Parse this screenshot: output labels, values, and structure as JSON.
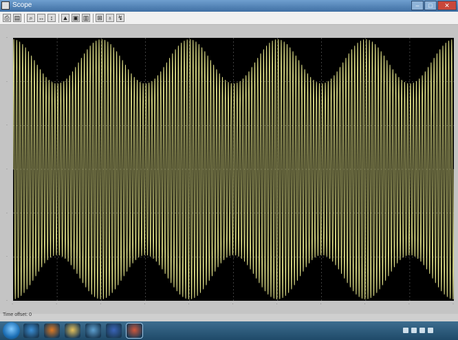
{
  "window": {
    "title": "Scope"
  },
  "toolbar": {
    "buttons": [
      {
        "name": "print-icon",
        "glyph": "⎙"
      },
      {
        "name": "parameters-icon",
        "glyph": "▤"
      },
      {
        "name": "zoom-icon",
        "glyph": "⌕"
      },
      {
        "name": "zoom-x-icon",
        "glyph": "↔"
      },
      {
        "name": "zoom-y-icon",
        "glyph": "↕"
      },
      {
        "name": "autoscale-icon",
        "glyph": "▲"
      },
      {
        "name": "save-axes-icon",
        "glyph": "▣"
      },
      {
        "name": "restore-axes-icon",
        "glyph": "▥"
      },
      {
        "name": "floating-scope-icon",
        "glyph": "⊞"
      },
      {
        "name": "lock-axes-icon",
        "glyph": "♁"
      },
      {
        "name": "signal-selection-icon",
        "glyph": "↯"
      }
    ]
  },
  "plot": {
    "background": "#000000",
    "trace_color": "#e5e58a",
    "grid_color": "#6a6a6a",
    "carrier_cycles": 150,
    "envelope_cycles": 5,
    "modulation_depth": 0.34,
    "y_range": [
      -1,
      1
    ]
  },
  "status": {
    "text": "Time offset:  0"
  },
  "taskbar": {
    "apps": [
      {
        "name": "ie-icon",
        "color": "#3b8fd6"
      },
      {
        "name": "firefox-icon",
        "color": "#e07a22"
      },
      {
        "name": "explorer-icon",
        "color": "#e8c25a"
      },
      {
        "name": "media-icon",
        "color": "#5ea0d0"
      },
      {
        "name": "word-icon",
        "color": "#3a64b8"
      },
      {
        "name": "matlab-icon",
        "color": "#d2573a"
      }
    ],
    "clock": {
      "time": "",
      "date": ""
    }
  }
}
